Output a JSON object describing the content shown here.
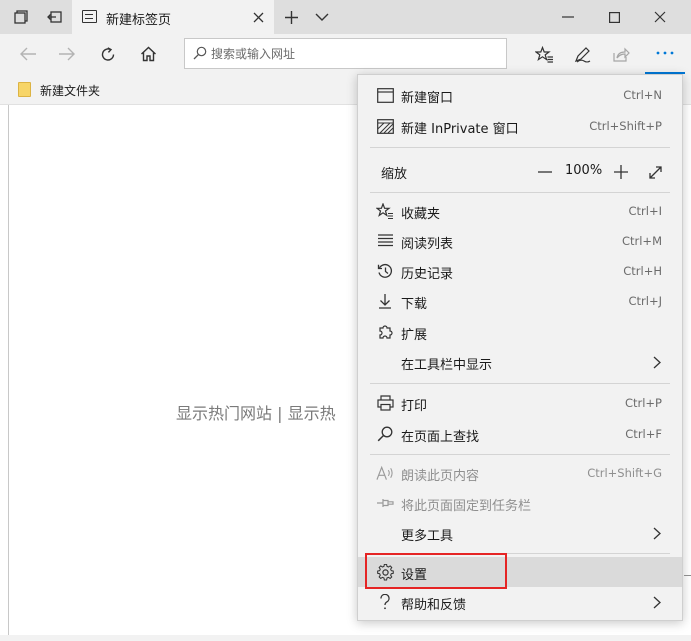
{
  "tab": {
    "title": "新建标签页"
  },
  "address": {
    "placeholder": "搜索或输入网址"
  },
  "favorites_bar": {
    "folder_label": "新建文件夹"
  },
  "content": {
    "text": "显示热门网站 | 显示热"
  },
  "menu": {
    "new_window": {
      "label": "新建窗口",
      "shortcut": "Ctrl+N"
    },
    "new_inprivate": {
      "label": "新建 InPrivate 窗口",
      "shortcut": "Ctrl+Shift+P"
    },
    "zoom": {
      "label": "缩放",
      "value": "100%"
    },
    "favorites": {
      "label": "收藏夹",
      "shortcut": "Ctrl+I"
    },
    "reading_list": {
      "label": "阅读列表",
      "shortcut": "Ctrl+M"
    },
    "history": {
      "label": "历史记录",
      "shortcut": "Ctrl+H"
    },
    "downloads": {
      "label": "下载",
      "shortcut": "Ctrl+J"
    },
    "extensions": {
      "label": "扩展"
    },
    "show_in_toolbar": {
      "label": "在工具栏中显示"
    },
    "print": {
      "label": "打印",
      "shortcut": "Ctrl+P"
    },
    "find_on_page": {
      "label": "在页面上查找",
      "shortcut": "Ctrl+F"
    },
    "read_aloud": {
      "label": "朗读此页内容",
      "shortcut": "Ctrl+Shift+G"
    },
    "pin_to_taskbar": {
      "label": "将此页面固定到任务栏"
    },
    "more_tools": {
      "label": "更多工具"
    },
    "settings": {
      "label": "设置"
    },
    "help_feedback": {
      "label": "帮助和反馈"
    }
  },
  "colors": {
    "accent": "#0078d7",
    "highlight_box": "#e52424",
    "menu_bg": "#f2f2f2",
    "selected_bg": "#dadada",
    "folder": "#f7d568"
  }
}
